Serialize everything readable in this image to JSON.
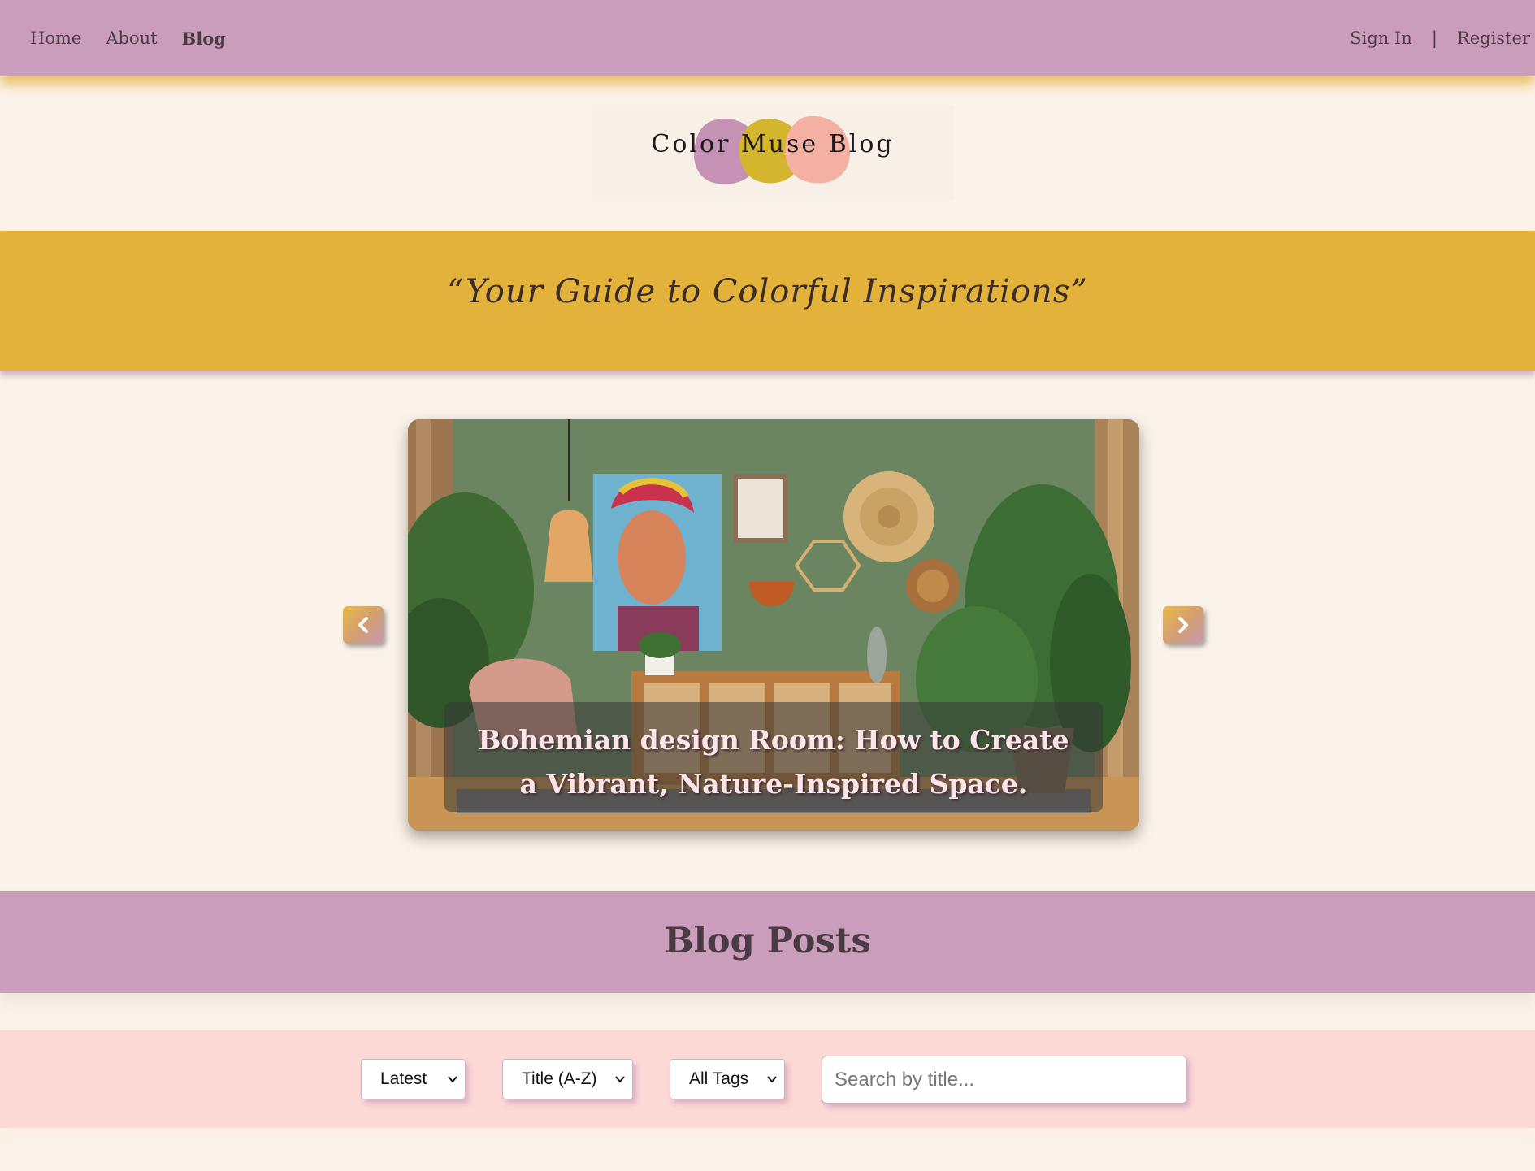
{
  "nav": {
    "left": [
      {
        "label": "Home",
        "active": false
      },
      {
        "label": "About",
        "active": false
      },
      {
        "label": "Blog",
        "active": true
      }
    ],
    "sign_in": "Sign In",
    "separator": "|",
    "register": "Register"
  },
  "logo": {
    "text": "Color Muse Blog",
    "blob_colors": [
      "#c591b4",
      "#d4b52e",
      "#f4b0a3"
    ]
  },
  "tagline": "“Your Guide to Colorful Inspirations”",
  "carousel": {
    "caption": "Bohemian design Room: How to Create a Vibrant, Nature-Inspired Space.",
    "prev_icon": "chevron-left-icon",
    "next_icon": "chevron-right-icon"
  },
  "posts": {
    "heading": "Blog Posts"
  },
  "filters": {
    "sort_date": "Latest",
    "sort_title": "Title (A-Z)",
    "tags": "All Tags",
    "search_placeholder": "Search by title..."
  },
  "colors": {
    "nav_bg": "#cb9dbc",
    "accent_yellow": "#e3b23b",
    "page_bg": "#fbf3ea",
    "filter_bg": "#fdd9d6"
  }
}
